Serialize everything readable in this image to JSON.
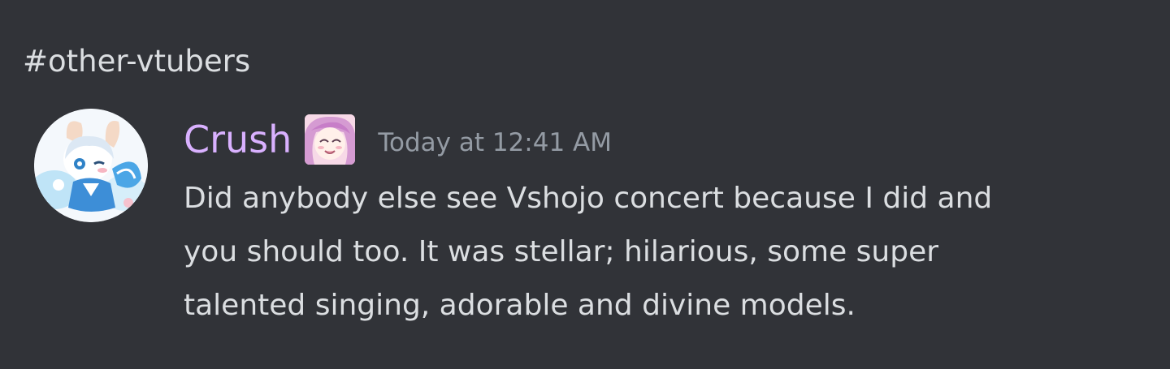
{
  "channel": {
    "name": "#other-vtubers"
  },
  "message": {
    "author": {
      "name": "Crush",
      "name_color": "#d9b1ff",
      "avatar_icon": "avatar-image",
      "badge_icon": "anime-girl-role-icon"
    },
    "timestamp": "Today at 12:41 AM",
    "content_lines": [
      "Did anybody else see Vshojo concert because I did and",
      "you should too. It was stellar; hilarious, some super",
      "talented singing, adorable and divine models."
    ]
  },
  "theme": {
    "background": "#313338",
    "text": "#dbdee1",
    "muted": "#949ba4"
  }
}
